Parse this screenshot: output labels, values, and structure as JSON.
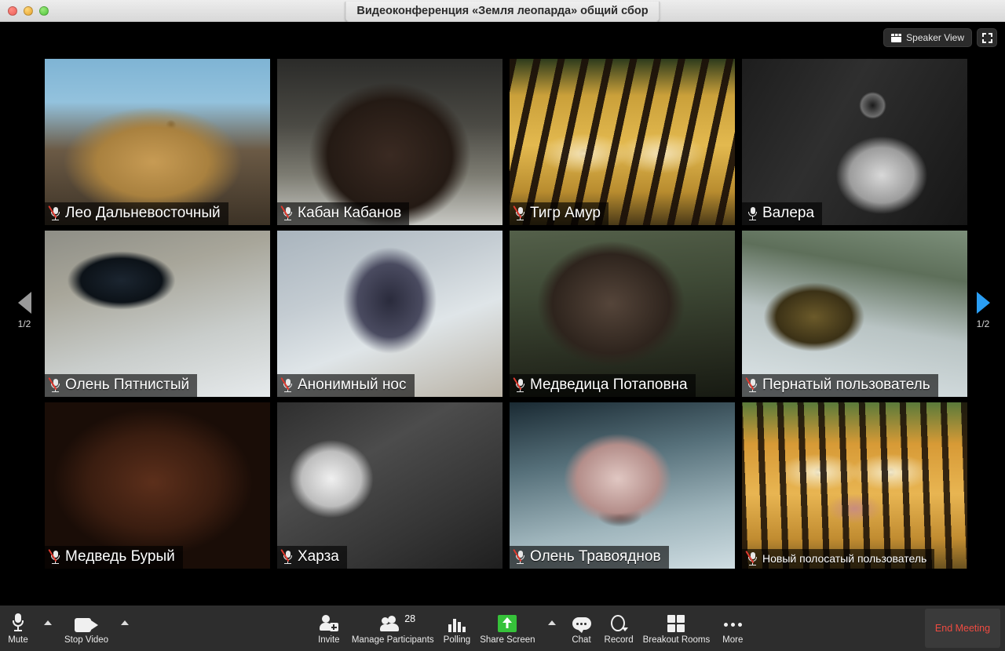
{
  "window": {
    "title": "Видеоконференция «Земля леопарда» общий сбор",
    "traffic_lights": [
      "close",
      "minimize",
      "maximize"
    ]
  },
  "view_controls": {
    "speaker_view_label": "Speaker View",
    "speaker_view_icon": "gallery-grid-icon",
    "fullscreen_icon": "enter-fullscreen-icon"
  },
  "pager": {
    "left_label": "1/2",
    "right_label": "1/2",
    "left_icon": "chevron-left-icon",
    "right_icon": "chevron-right-icon",
    "left_enabled_color": "#9a9a9a",
    "right_enabled_color": "#2a9ef4"
  },
  "gallery": {
    "columns": 4,
    "rows": 3,
    "participants": [
      {
        "name": "Лео Дальневосточный",
        "muted": true,
        "art": "bg-leopard1",
        "small": false
      },
      {
        "name": "Кабан Кабанов",
        "muted": true,
        "art": "bg-boar",
        "small": false
      },
      {
        "name": "Тигр Амур",
        "muted": true,
        "art": "bg-tiger1",
        "small": false
      },
      {
        "name": "Валера",
        "muted": false,
        "art": "bg-leopardBW",
        "small": false
      },
      {
        "name": "Олень Пятнистый",
        "muted": true,
        "art": "bg-deer1",
        "small": false
      },
      {
        "name": "Анонимный нос",
        "muted": true,
        "art": "bg-nose",
        "small": false
      },
      {
        "name": "Медведица Потаповна",
        "muted": true,
        "art": "bg-bear1",
        "small": false
      },
      {
        "name": "Пернатый пользователь",
        "muted": true,
        "art": "bg-bird",
        "small": false
      },
      {
        "name": "Медведь Бурый",
        "muted": true,
        "art": "bg-bear2",
        "small": false
      },
      {
        "name": "Харза",
        "muted": true,
        "art": "bg-harza",
        "small": false
      },
      {
        "name": "Олень Травояднов",
        "muted": true,
        "art": "bg-deer2",
        "small": false
      },
      {
        "name": "Новый полосатый пользователь",
        "muted": true,
        "art": "bg-tiger2",
        "small": true
      }
    ]
  },
  "toolbar": {
    "mute_label": "Mute",
    "mute_icon": "microphone-icon",
    "audio_caret_icon": "chevron-up-icon",
    "stop_video_label": "Stop Video",
    "stop_video_icon": "camera-icon",
    "video_caret_icon": "chevron-up-icon",
    "invite_label": "Invite",
    "invite_icon": "person-add-icon",
    "participants_label": "Manage Participants",
    "participants_icon": "people-icon",
    "participants_count": "28",
    "polling_label": "Polling",
    "polling_icon": "bar-chart-icon",
    "share_screen_label": "Share Screen",
    "share_screen_icon": "share-up-arrow-icon",
    "share_caret_icon": "chevron-up-icon",
    "chat_label": "Chat",
    "chat_icon": "chat-bubble-icon",
    "record_label": "Record",
    "record_icon": "record-circle-icon",
    "breakout_label": "Breakout Rooms",
    "breakout_icon": "four-squares-icon",
    "more_label": "More",
    "more_icon": "ellipsis-icon",
    "end_meeting_label": "End Meeting",
    "end_meeting_color": "#ef4b41"
  }
}
